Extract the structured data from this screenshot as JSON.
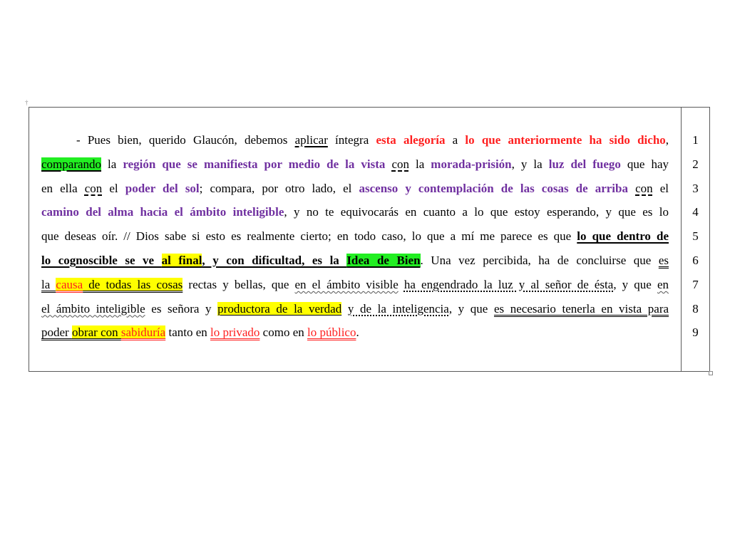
{
  "document": {
    "paragraph": {
      "l1": {
        "a": "- Pues bien, querido Glaucón, debemos ",
        "b": "aplicar",
        "c": " íntegra ",
        "d": "esta alegoría",
        "e": " a ",
        "f": "lo que anteriormente ha sido dicho",
        "g": ","
      },
      "l2": {
        "a": "comparando",
        "b": " la ",
        "c": "región que se manifiesta por medio de la vista",
        "d": " ",
        "e": "con",
        "f": " la ",
        "g": "morada-prisión",
        "h": ", y la ",
        "i": "luz del fuego",
        "j": " que hay"
      },
      "l3": {
        "a": "en ella ",
        "b": "con",
        "c": " el ",
        "d": "poder del sol",
        "e": "; compara, por otro lado, el ",
        "f": "ascenso y contemplación de las cosas de arriba",
        "g": " ",
        "h": "con",
        "i": " el"
      },
      "l4": {
        "a": "camino del alma hacia el ámbito inteligible",
        "b": ", y no te equivocarás en cuanto a lo que estoy esperando, y que es lo"
      },
      "l5": {
        "a": "que deseas oír. // Dios sabe si esto es realmente cierto; en todo caso, lo que a mí me parece es que ",
        "b": "lo que dentro de"
      },
      "l6": {
        "a": "lo cognoscible se ve ",
        "b": "al final",
        "c": ", y con dificultad, es la ",
        "d": "Idea de Bien",
        "e": ". Una vez percibida, ha de concluirse que ",
        "f": "es"
      },
      "l7": {
        "a": "la ",
        "b": "causa",
        "c": " de todas las cosas",
        "d": " rectas y bellas, que ",
        "e": "en el ámbito visible",
        "f": " ",
        "g": "ha engendrado la luz y al señor de ésta",
        "h": ", y que ",
        "i": "en"
      },
      "l8": {
        "a": "el ámbito inteligible",
        "b": " es señora y ",
        "c": "productora de la verdad",
        "d": " ",
        "e": "y de la inteligencia",
        "f": ", y que ",
        "g": "es necesario tenerla en vista para"
      },
      "l9": {
        "a": "poder ",
        "b": "obrar con ",
        "c": "sabiduría",
        "d": " tanto en ",
        "e": "lo privado",
        "f": " como en ",
        "g": "lo público",
        "h": "."
      }
    },
    "line_numbers": [
      "1",
      "2",
      "3",
      "4",
      "5",
      "6",
      "7",
      "8",
      "9"
    ]
  },
  "colors": {
    "red_text": "#ff1f1f",
    "purple_text": "#7030a0",
    "green_highlight": "#22ee22",
    "yellow_highlight": "#ffff00",
    "border": "#5a5a5a"
  },
  "icons": [
    "paragraph-anchor-icon",
    "table-end-handle-icon"
  ]
}
